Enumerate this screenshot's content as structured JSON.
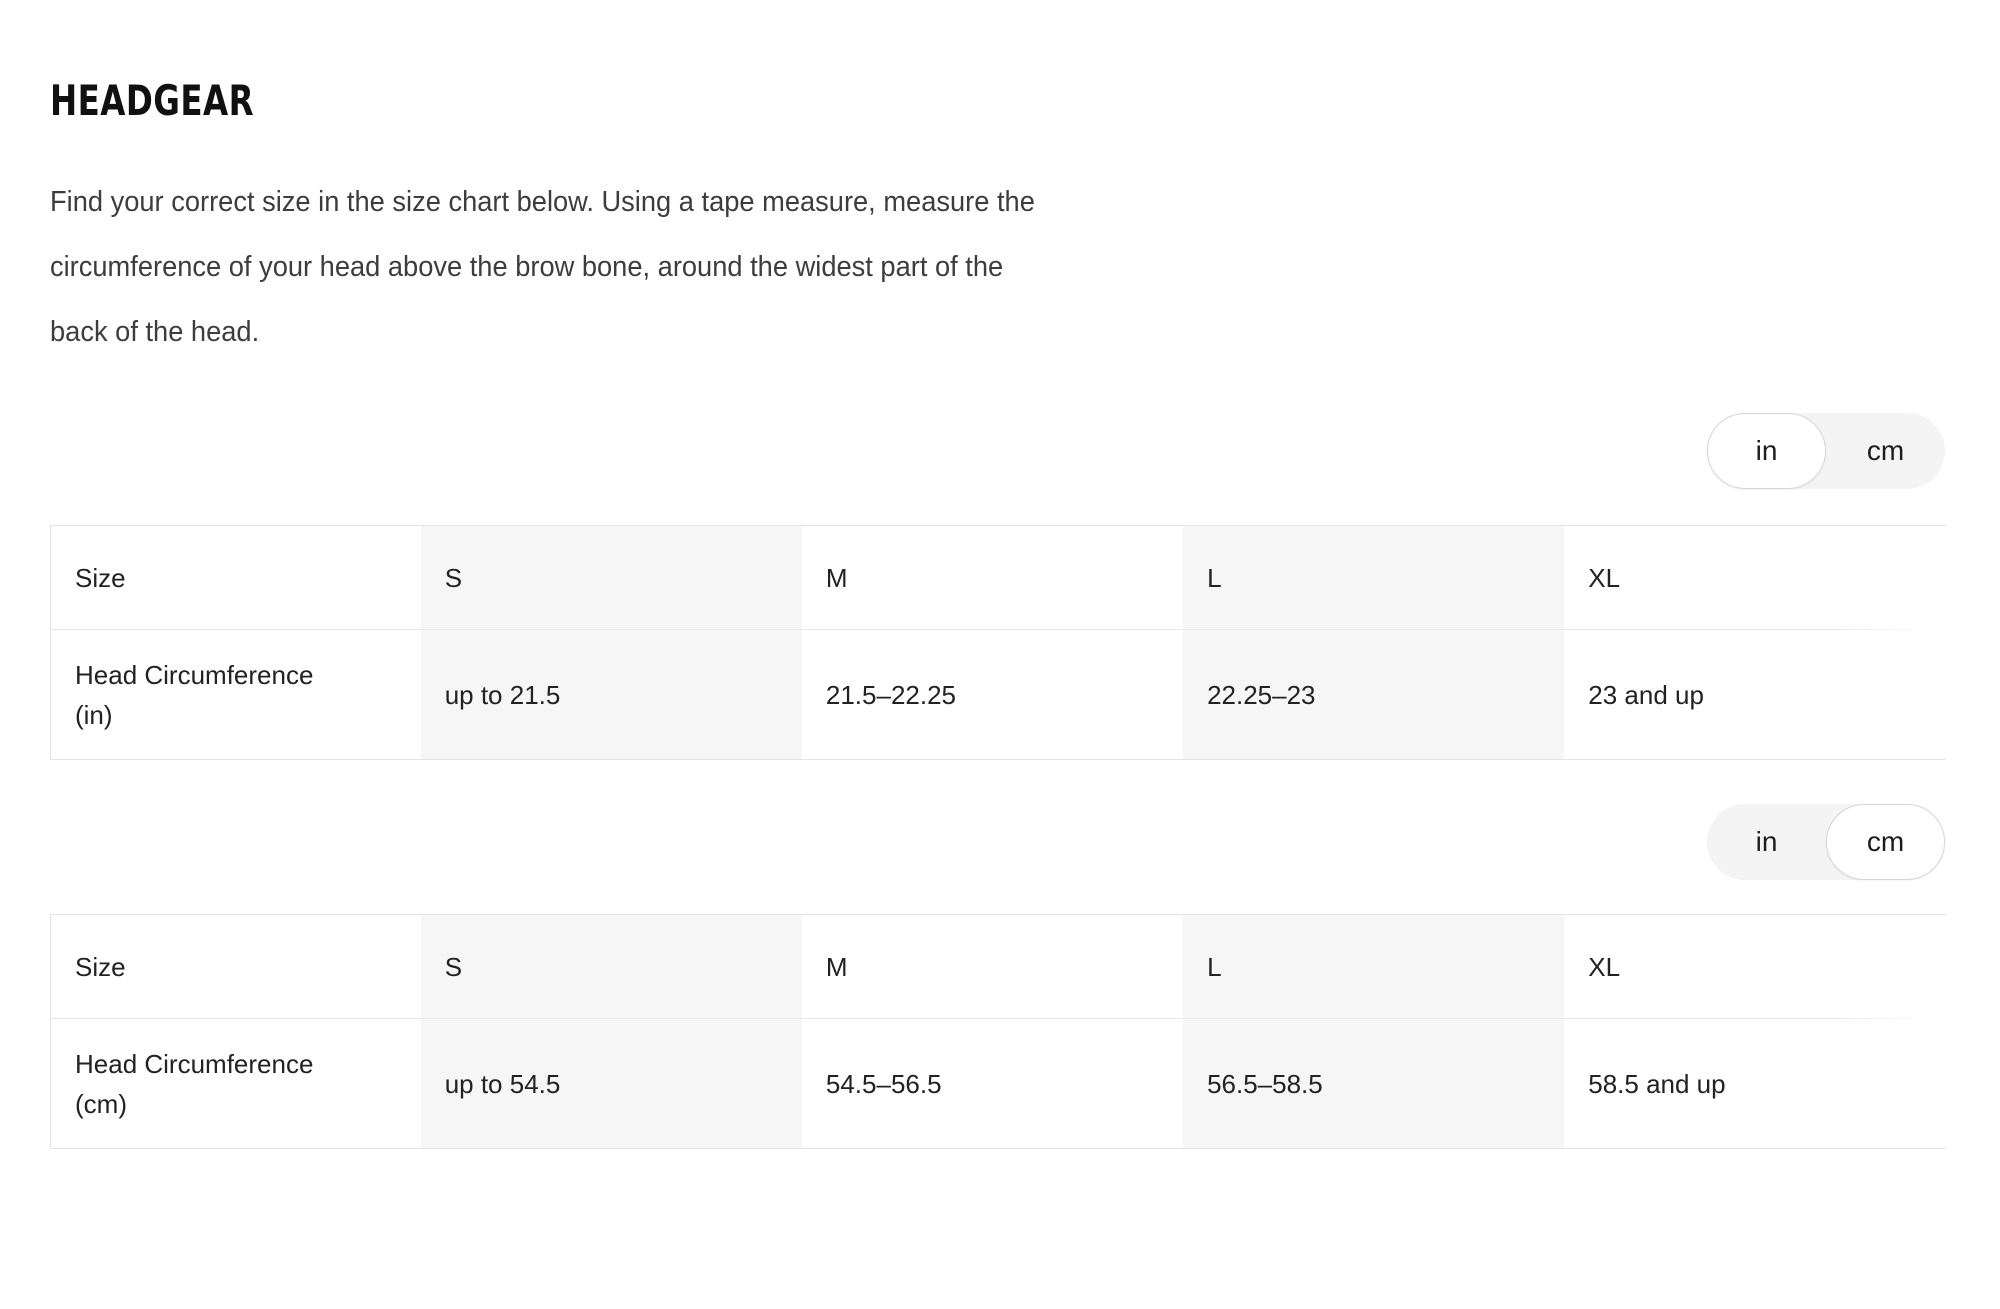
{
  "header": {
    "title": "HEADGEAR",
    "description": "Find your correct size in the size chart below. Using a tape measure, measure the circumference of your head above the brow bone, around the widest part of the back of the head."
  },
  "unit_toggle": {
    "options": [
      "in",
      "cm"
    ],
    "in_label": "in",
    "cm_label": "cm"
  },
  "tables": [
    {
      "unit": "in",
      "selected_unit": "in",
      "columns": [
        "Size",
        "S",
        "M",
        "L",
        "XL"
      ],
      "rows": [
        {
          "label": "Head Circumference (in)",
          "values": [
            "up to 21.5",
            "21.5–22.25",
            "22.25–23",
            "23 and up"
          ]
        }
      ]
    },
    {
      "unit": "cm",
      "selected_unit": "cm",
      "columns": [
        "Size",
        "S",
        "M",
        "L",
        "XL"
      ],
      "rows": [
        {
          "label": "Head Circumference (cm)",
          "values": [
            "up to 54.5",
            "54.5–56.5",
            "56.5–58.5",
            "58.5 and up"
          ]
        }
      ]
    }
  ]
}
